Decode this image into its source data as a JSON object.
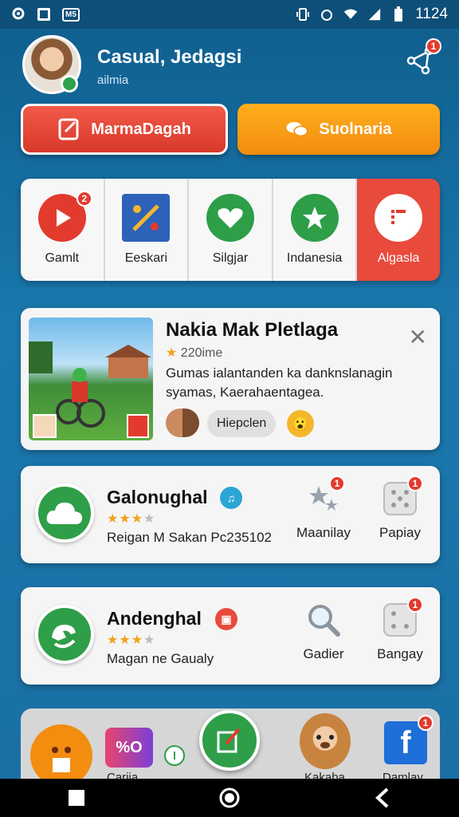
{
  "status_bar": {
    "time": "1124",
    "icons": [
      "location-icon",
      "square-icon",
      "tag-icon",
      "vibrate-icon",
      "alarm-icon",
      "wifi-icon",
      "signal-icon",
      "battery-icon"
    ],
    "tag_text": "M5"
  },
  "profile": {
    "name": "Casual, Jedagsi",
    "subtitle": "ailmia",
    "share_badge": "1"
  },
  "cta": {
    "primary_label": "MarmaDagah",
    "secondary_label": "Suolnaria"
  },
  "categories": [
    {
      "label": "Gamlt",
      "icon": "play-icon",
      "badge": "2"
    },
    {
      "label": "Eeskari",
      "icon": "tools-icon"
    },
    {
      "label": "Silgjar",
      "icon": "heart-icon"
    },
    {
      "label": "Indanesia",
      "icon": "star-icon"
    },
    {
      "label": "Algasla",
      "icon": "map-pin-icon"
    }
  ],
  "featured": {
    "title": "Nakia Mak Pletlaga",
    "rating": "220ime",
    "description": "Gumas ialantanden ka danknslanagin syamas, Kaerahaentagea.",
    "chip_label": "Hiepclen"
  },
  "apps": [
    {
      "name": "Galonughal",
      "stars": 3,
      "meta": "Reigan M Sakan  Pc235102",
      "actions": [
        {
          "label": "Maanilay",
          "icon": "stars-icon",
          "badge": "1"
        },
        {
          "label": "Papiay",
          "icon": "dice-icon",
          "badge": "1"
        }
      ]
    },
    {
      "name": "Andenghal",
      "stars": 3,
      "meta": "Magan ne Gaualy",
      "actions": [
        {
          "label": "Gadier",
          "icon": "magnifier-icon"
        },
        {
          "label": "Bangay",
          "icon": "dice-icon",
          "badge": "1"
        }
      ]
    }
  ],
  "dock": [
    {
      "label": "",
      "icon": "emoji-face-icon"
    },
    {
      "label": "Carija",
      "icon": "tag-app-icon"
    },
    {
      "label": "",
      "icon": "clock-icon"
    },
    {
      "label": "",
      "icon": "check-edit-icon"
    },
    {
      "label": "Kakaba",
      "icon": "bear-icon"
    },
    {
      "label": "Damlay",
      "icon": "facebook-icon",
      "badge": "1"
    }
  ],
  "colors": {
    "accent_red": "#d8382a",
    "accent_orange": "#f28d10",
    "green": "#2e9e48"
  }
}
